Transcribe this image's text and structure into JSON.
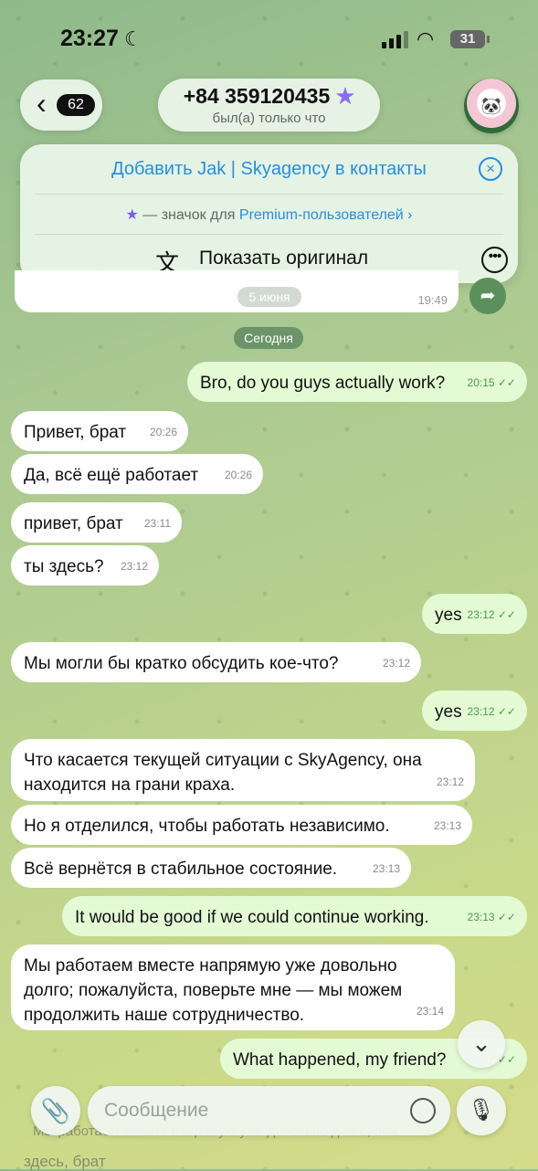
{
  "status": {
    "time": "23:27",
    "battery": "31"
  },
  "header": {
    "back_count": "62",
    "title": "+84 359120435",
    "subtitle": "был(а) только что"
  },
  "banner": {
    "add_contact": "Добавить Jak | Skyagency в контакты",
    "premium_prefix": "— значок для",
    "premium_link": "Premium-пользователей",
    "show_original": "Показать оригинал"
  },
  "history": {
    "date_chip": "5 июня",
    "last_time": "19:49"
  },
  "today_label": "Сегодня",
  "messages": [
    {
      "dir": "out",
      "text": "Bro, do you guys actually work?",
      "time": "20:15"
    },
    {
      "dir": "in",
      "text": "Привет, брат",
      "time": "20:26"
    },
    {
      "dir": "in",
      "text": "Да, всё ещё работает",
      "time": "20:26"
    },
    {
      "dir": "in",
      "text": "привет, брат",
      "time": "23:11"
    },
    {
      "dir": "in",
      "text": "ты здесь?",
      "time": "23:12"
    },
    {
      "dir": "out",
      "text": "yes",
      "time": "23:12"
    },
    {
      "dir": "in",
      "text": "Мы могли бы кратко обсудить кое-что?",
      "time": "23:12"
    },
    {
      "dir": "out",
      "text": "yes",
      "time": "23:12"
    },
    {
      "dir": "in",
      "text": "Что касается текущей ситуации с SkyAgency, она находится на грани краха.",
      "time": "23:12"
    },
    {
      "dir": "in",
      "text": "Но я отделился, чтобы работать независимо.",
      "time": "23:13"
    },
    {
      "dir": "in",
      "text": "Всё вернётся в стабильное состояние.",
      "time": "23:13"
    },
    {
      "dir": "out",
      "text": "It would be good if we could continue working.",
      "time": "23:13"
    },
    {
      "dir": "in",
      "text": "Мы работаем вместе напрямую уже довольно долго; пожалуйста, поверьте мне — мы можем продолжить наше сотрудничество.",
      "time": "23:14"
    },
    {
      "dir": "out",
      "text": "What happened, my friend?",
      "time": ""
    }
  ],
  "composer": {
    "placeholder": "Сообщение",
    "reply_preview": "Мы работаем вместе напрямую уже довольно долго; пож...",
    "below_text": "здесь, брат"
  },
  "icons": [
    "moon-icon",
    "wifi-icon",
    "chevron-left-icon",
    "premium-star-icon",
    "close-circle-icon",
    "translate-icon",
    "more-icon",
    "forward-icon",
    "chevron-down-icon",
    "paperclip-icon",
    "sticker-icon",
    "microphone-icon"
  ]
}
